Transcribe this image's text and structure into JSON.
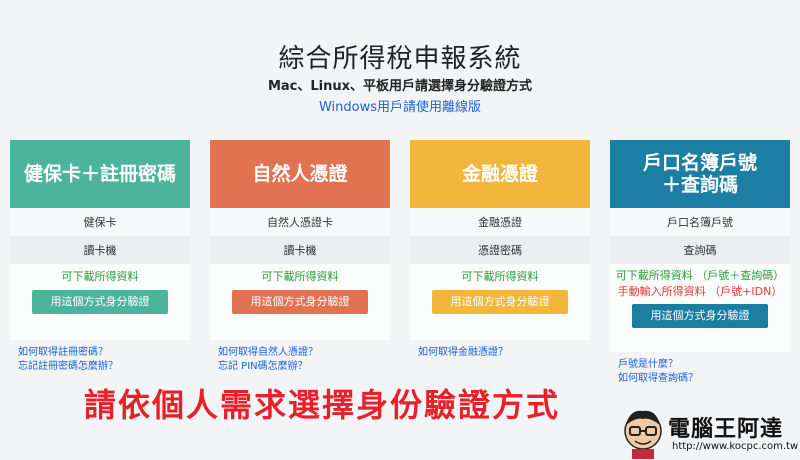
{
  "header": {
    "title": "綜合所得稅申報系統",
    "subtitle": "Mac、Linux、平板用戶請選擇身分驗證方式",
    "windows_link": "Windows用戶請使用離線版"
  },
  "cards": [
    {
      "title": "健保卡＋註冊密碼",
      "color": "#4bb49a",
      "row1": "健保卡",
      "row2": "讀卡機",
      "note_green": "可下載所得資料",
      "note_red": "",
      "button": "用這個方式身分驗證",
      "links": [
        "如何取得註冊密碼？",
        "忘記註冊密碼怎麼辦？"
      ]
    },
    {
      "title": "自然人憑證",
      "color": "#e27352",
      "row1": "自然人憑證卡",
      "row2": "讀卡機",
      "note_green": "可下載所得資料",
      "note_red": "",
      "button": "用這個方式身分驗證",
      "links": [
        "如何取得自然人憑證？",
        "忘記 PIN碼怎麼辦？"
      ]
    },
    {
      "title": "金融憑證",
      "color": "#f2b63c",
      "row1": "金融憑證",
      "row2": "憑證密碼",
      "note_green": "可下載所得資料",
      "note_red": "",
      "button": "用這個方式身分驗證",
      "links": [
        "如何取得金融憑證？"
      ]
    },
    {
      "title": "戶口名簿戶號\n＋查詢碼",
      "color": "#1b7fa3",
      "row1": "戶口名簿戶號",
      "row2": "查詢碼",
      "note_green": "可下載所得資料 （戶號＋查詢碼）",
      "note_red": "手動輸入所得資料 （戶號+IDN）",
      "button": "用這個方式身分驗證",
      "links": [
        "戶號是什麼？",
        "如何取得查詢碼？"
      ]
    }
  ],
  "banner": "請依個人需求選擇身份驗證方式",
  "logo": {
    "name": "電腦王阿達",
    "url": "http://www.kocpc.com.tw"
  }
}
